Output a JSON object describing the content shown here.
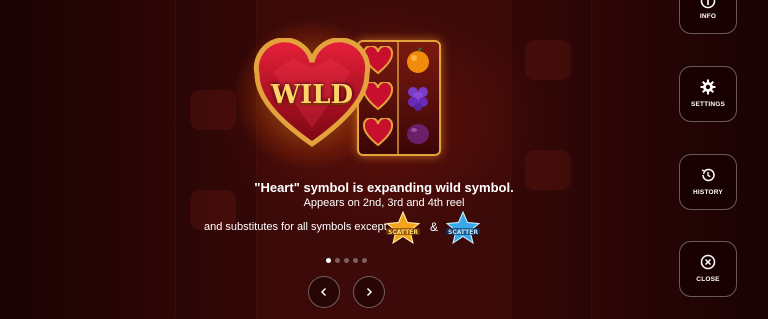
{
  "paytable": {
    "illustration": {
      "wild_label": "WILD",
      "icon": "heart-wild-symbol-icon"
    },
    "caption": {
      "line1": "\"Heart\" symbol is expanding wild symbol.",
      "line2": "Appears on 2nd, 3rd and 4th reel",
      "line3": "and substitutes for all symbols except",
      "conjunction": "&"
    },
    "scatter_badges": [
      {
        "label": "SCATTER",
        "color": "#f2a51a",
        "icon": "gold-star-scatter-icon"
      },
      {
        "label": "SCATTER",
        "color": "#3aa7e8",
        "icon": "blue-star-scatter-icon"
      }
    ],
    "pagination": {
      "pages": 5,
      "current": 1
    },
    "nav": {
      "prev_icon": "chevron-left-icon",
      "next_icon": "chevron-right-icon"
    }
  },
  "side_menu": {
    "info": {
      "label": "INFO",
      "icon": "info-icon"
    },
    "settings": {
      "label": "SETTINGS",
      "icon": "gear-icon"
    },
    "history": {
      "label": "HISTORY",
      "icon": "history-icon"
    },
    "close": {
      "label": "CLOSE",
      "icon": "close-icon"
    }
  },
  "colors": {
    "gold": "#e3a23b",
    "heart_red": "#c8102e",
    "accent_text": "#ffd36a"
  }
}
